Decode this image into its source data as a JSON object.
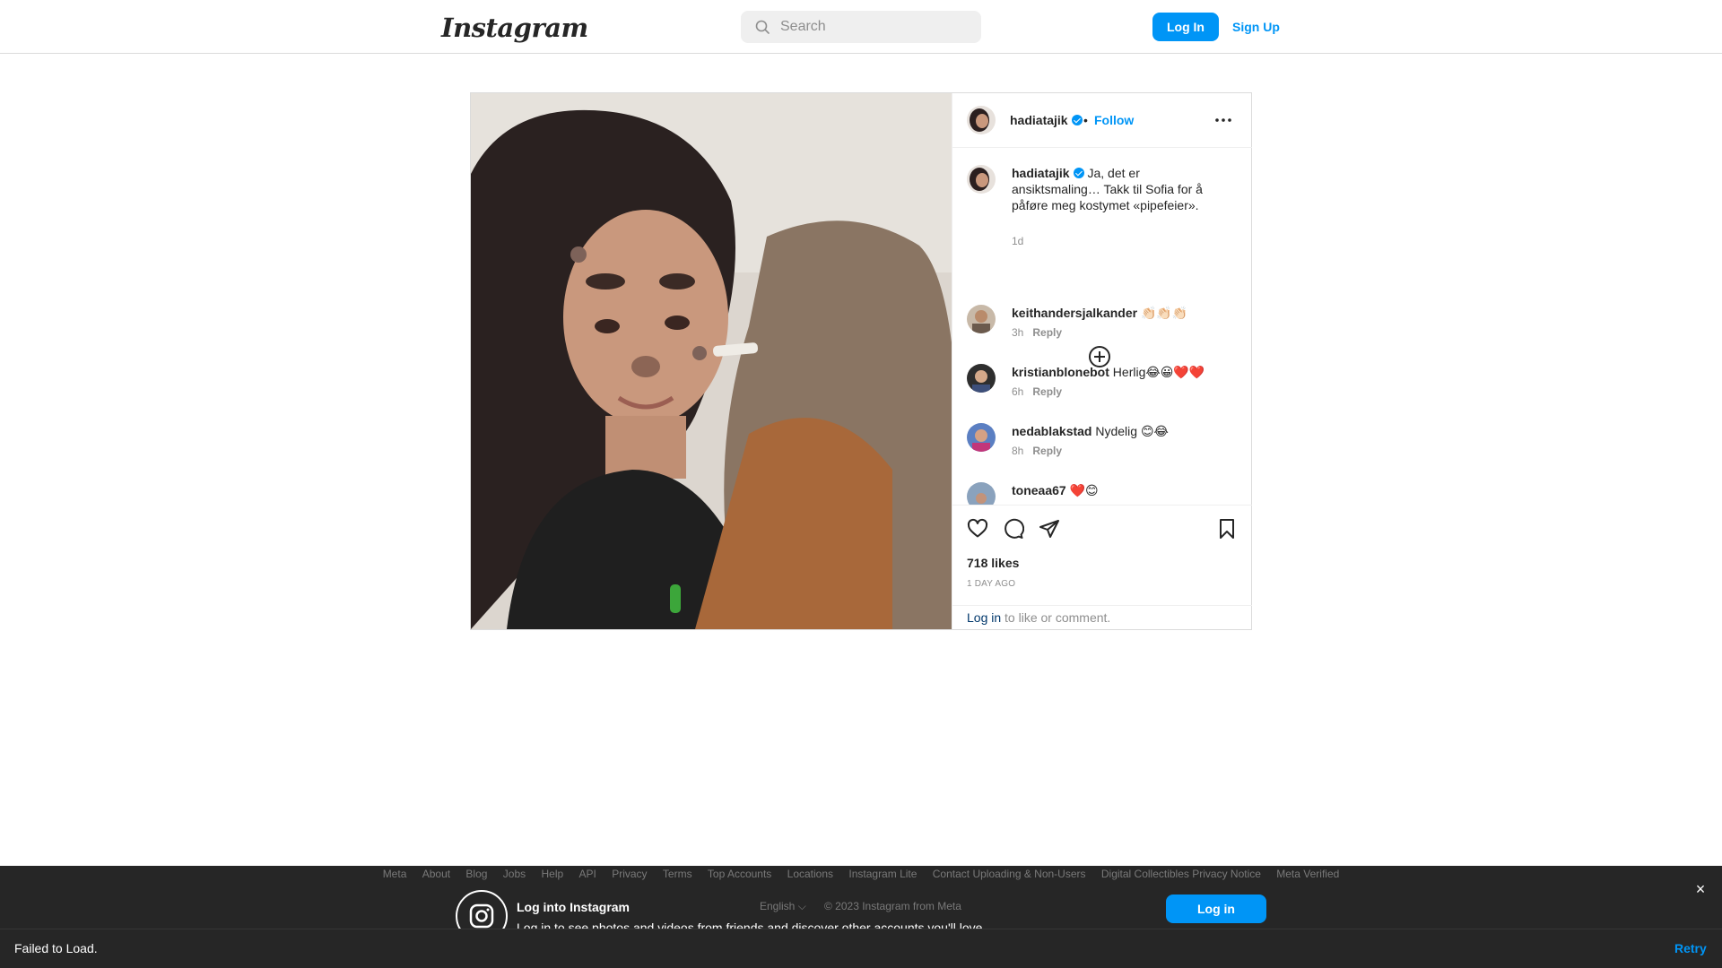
{
  "topnav": {
    "logo": "Instagram",
    "search_placeholder": "Search",
    "login_label": "Log In",
    "signup_label": "Sign Up"
  },
  "post": {
    "author": "hadiatajik",
    "follow_label": "Follow",
    "separator": "•",
    "caption": {
      "username": "hadiatajik",
      "text": "Ja, det er ansiktsmaling… Takk til Sofia for å påføre meg kostymet «pipefeier».",
      "time": "1d"
    },
    "comments": [
      {
        "username": "keithandersjalkander",
        "text": "👏🏻👏🏻👏🏻",
        "time": "3h",
        "reply": "Reply"
      },
      {
        "username": "kristianblonebot",
        "text": "Herlig😂😀❤️❤️",
        "time": "6h",
        "reply": "Reply"
      },
      {
        "username": "nedablakstad",
        "text": "Nydelig 😊😂",
        "time": "8h",
        "reply": "Reply"
      },
      {
        "username": "toneaa67",
        "text": "❤️😊",
        "time": "",
        "reply": ""
      }
    ],
    "likes": "718 likes",
    "posted": "1 DAY AGO",
    "login_prompt": {
      "link": "Log in",
      "rest": " to like or comment."
    }
  },
  "banner": {
    "footer_links": [
      "Meta",
      "About",
      "Blog",
      "Jobs",
      "Help",
      "API",
      "Privacy",
      "Terms",
      "Top Accounts",
      "Locations",
      "Instagram Lite",
      "Contact Uploading & Non-Users",
      "Digital Collectibles Privacy Notice",
      "Meta Verified"
    ],
    "title": "Log into Instagram",
    "subtitle": "Log in to see photos and videos from friends and discover other accounts you'll love.",
    "language": "English ⌵",
    "copyright": "© 2023 Instagram from Meta",
    "login_label": "Log in",
    "close": "×"
  },
  "toast": {
    "message": "Failed to Load.",
    "retry": "Retry"
  },
  "colors": {
    "accent": "#0095f6",
    "link_dark": "#00376b",
    "banner_bg": "#262626"
  }
}
